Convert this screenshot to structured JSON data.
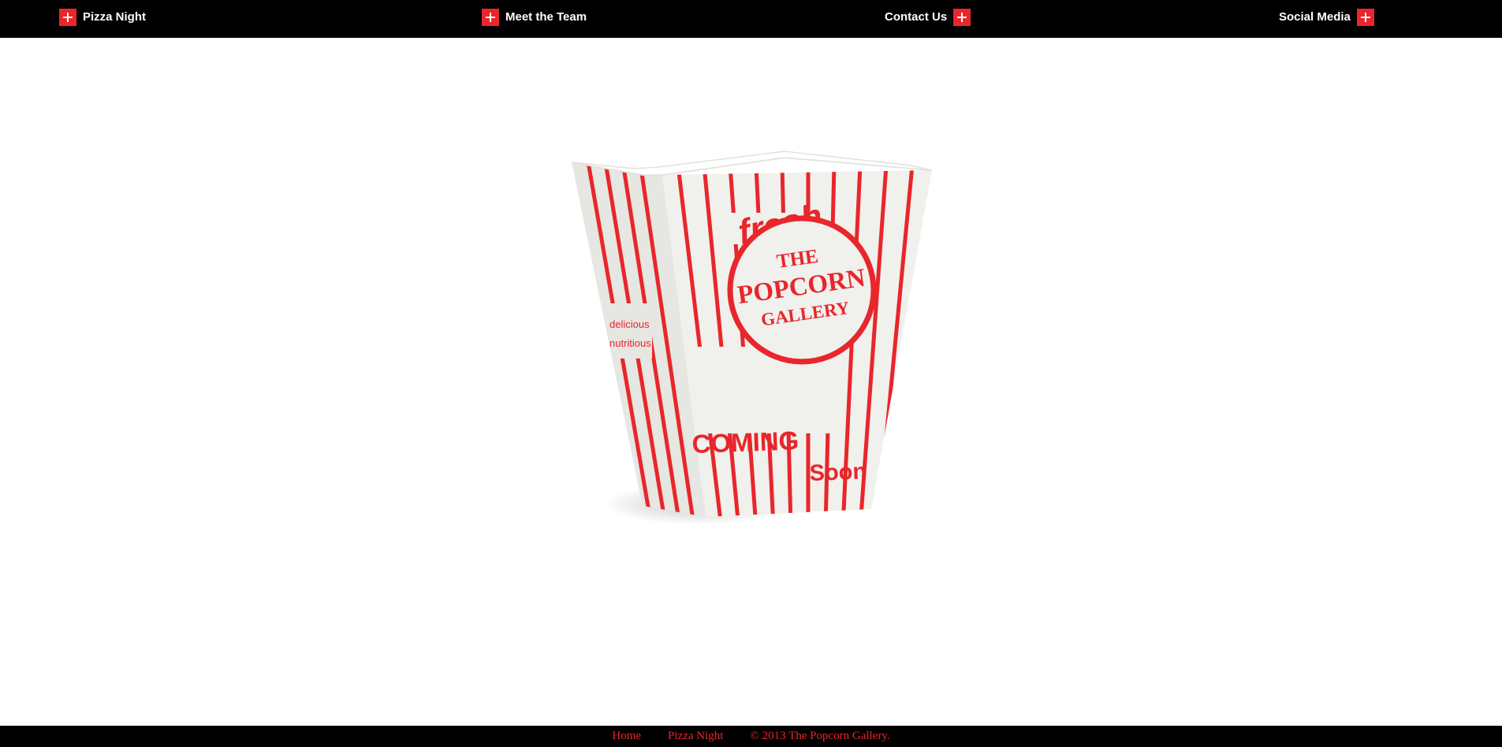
{
  "nav": {
    "items": [
      {
        "label": "Pizza Night",
        "icon": "plus-icon"
      },
      {
        "label": "Meet the Team",
        "icon": "plus-icon"
      },
      {
        "label": "Contact Us",
        "icon": "plus-icon"
      },
      {
        "label": "Social Media",
        "icon": "plus-icon"
      }
    ]
  },
  "hero": {
    "box_text": {
      "fresh": "fresh",
      "line1": "THE",
      "line2": "POPCORN",
      "line3": "GALLERY",
      "coming": "COMING",
      "soon": "Soon",
      "side1": "delicious",
      "side2": "nutritious"
    }
  },
  "footer": {
    "home": "Home",
    "pizza_night": "Pizza Night",
    "copyright": "© 2013 The Popcorn Gallery."
  },
  "colors": {
    "bar_background": "#000000",
    "accent_red": "#e8262b",
    "nav_text": "#ffffff"
  }
}
